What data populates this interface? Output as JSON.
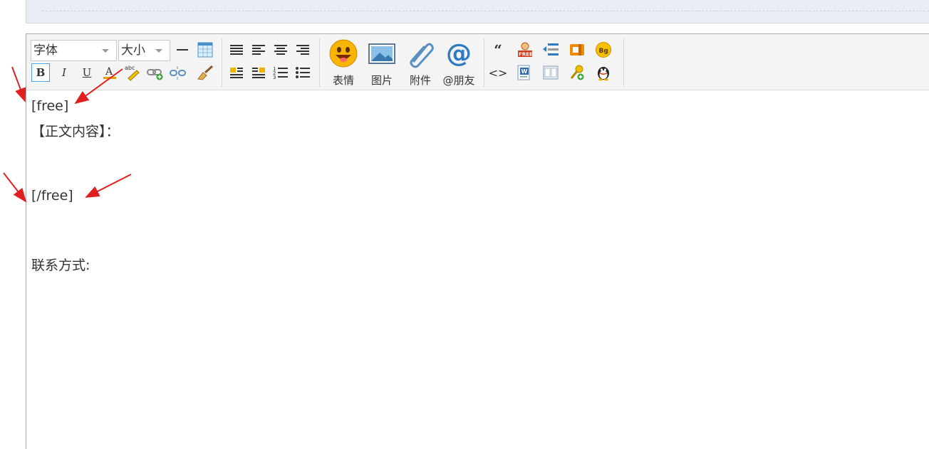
{
  "toolbar": {
    "font_select": {
      "value": "字体"
    },
    "size_select": {
      "value": "大小"
    },
    "emoji_label": "表情",
    "image_label": "图片",
    "attach_label": "附件",
    "at_friend_label": "@朋友"
  },
  "content": {
    "lines": [
      "[free]",
      "【正文内容】：",
      "[/free]",
      "联系方式:"
    ]
  },
  "colors": {
    "accent_arrow": "#e02020",
    "toolbar_bg": "#f4f4f4",
    "active_border": "#4aa3e8"
  }
}
